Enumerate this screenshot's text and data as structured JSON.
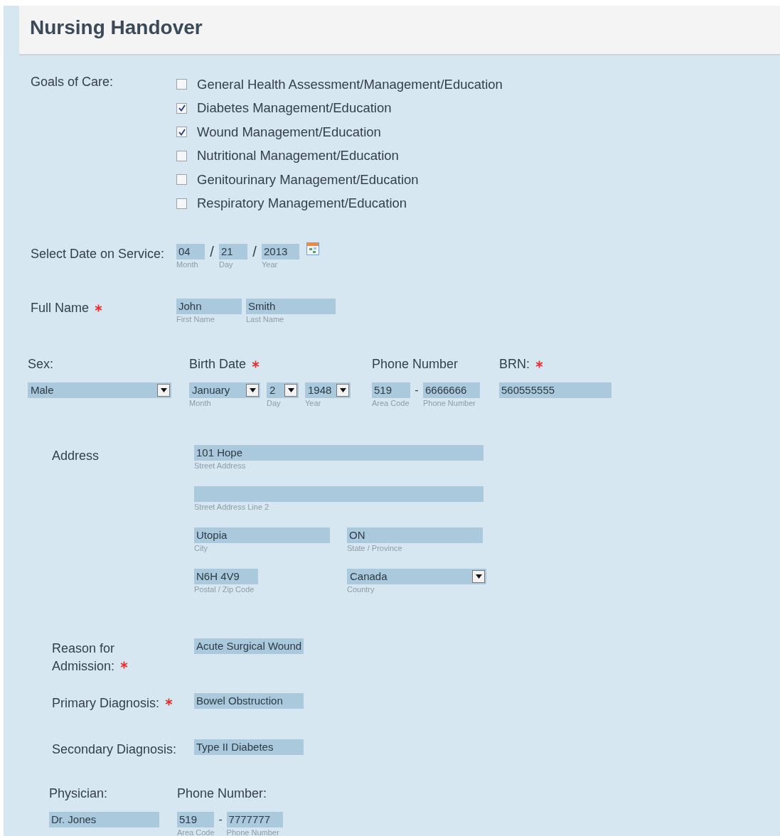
{
  "title": "Nursing Handover",
  "goals": {
    "label": "Goals of Care:",
    "options": [
      {
        "label": "General Health Assessment/Management/Education",
        "checked": false
      },
      {
        "label": "Diabetes Management/Education",
        "checked": true
      },
      {
        "label": "Wound Management/Education",
        "checked": true
      },
      {
        "label": "Nutritional Management/Education",
        "checked": false
      },
      {
        "label": "Genitourinary Management/Education",
        "checked": false
      },
      {
        "label": "Respiratory Management/Education",
        "checked": false
      }
    ]
  },
  "service_date": {
    "label": "Select Date on Service:",
    "separators": [
      "/",
      "/"
    ],
    "fields": [
      {
        "kind": "text",
        "value": "04",
        "caption": "Month"
      },
      {
        "kind": "text",
        "value": "21",
        "caption": "Day"
      },
      {
        "kind": "text",
        "value": "2013",
        "caption": "Year"
      }
    ]
  },
  "full_name": {
    "label": "Full Name",
    "required": true,
    "fields": [
      {
        "kind": "text",
        "value": "John",
        "caption": "First Name"
      },
      {
        "kind": "text",
        "value": "Smith",
        "caption": "Last Name"
      }
    ]
  },
  "sex": {
    "label": "Sex:",
    "required": false,
    "field": {
      "kind": "select",
      "value": "Male"
    }
  },
  "birth_date": {
    "label": "Birth Date",
    "required": true,
    "fields": [
      {
        "kind": "select",
        "value": "January",
        "caption": "Month"
      },
      {
        "kind": "select",
        "value": "2",
        "caption": "Day"
      },
      {
        "kind": "select",
        "value": "1948",
        "caption": "Year"
      }
    ]
  },
  "phone": {
    "label": "Phone Number",
    "required": false,
    "separator": "-",
    "fields": [
      {
        "kind": "text",
        "value": "519",
        "caption": "Area Code"
      },
      {
        "kind": "text",
        "value": "6666666",
        "caption": "Phone Number"
      }
    ]
  },
  "brn": {
    "label": "BRN:",
    "required": true,
    "field": {
      "kind": "text",
      "value": "560555555"
    }
  },
  "address": {
    "label": "Address",
    "fields": [
      {
        "kind": "text",
        "value": "101 Hope",
        "caption": "Street Address"
      },
      {
        "kind": "text",
        "caption": "Street Address Line 2"
      },
      {
        "kind": "text",
        "value": "Utopia",
        "caption": "City"
      },
      {
        "kind": "text",
        "value": "ON",
        "caption": "State / Province"
      },
      {
        "kind": "text",
        "value": "N6H 4V9",
        "caption": "Postal / Zip Code"
      },
      {
        "kind": "select",
        "value": "Canada",
        "caption": "Country"
      }
    ]
  },
  "clinical": [
    {
      "label": "Reason for Admission:",
      "required": true,
      "value": "Acute Surgical Wound"
    },
    {
      "label": "Primary Diagnosis:",
      "required": true,
      "value": "Bowel Obstruction"
    },
    {
      "label": "Secondary Diagnosis:",
      "required": false,
      "value": "Type II Diabetes"
    }
  ],
  "physician": {
    "label": "Physician:",
    "field": {
      "kind": "text",
      "value": "Dr. Jones"
    }
  },
  "physician_phone": {
    "label": "Phone Number:",
    "separator": "-",
    "fields": [
      {
        "kind": "text",
        "value": "519",
        "caption": "Area Code"
      },
      {
        "kind": "text",
        "value": "7777777",
        "caption": "Phone Number"
      }
    ]
  }
}
